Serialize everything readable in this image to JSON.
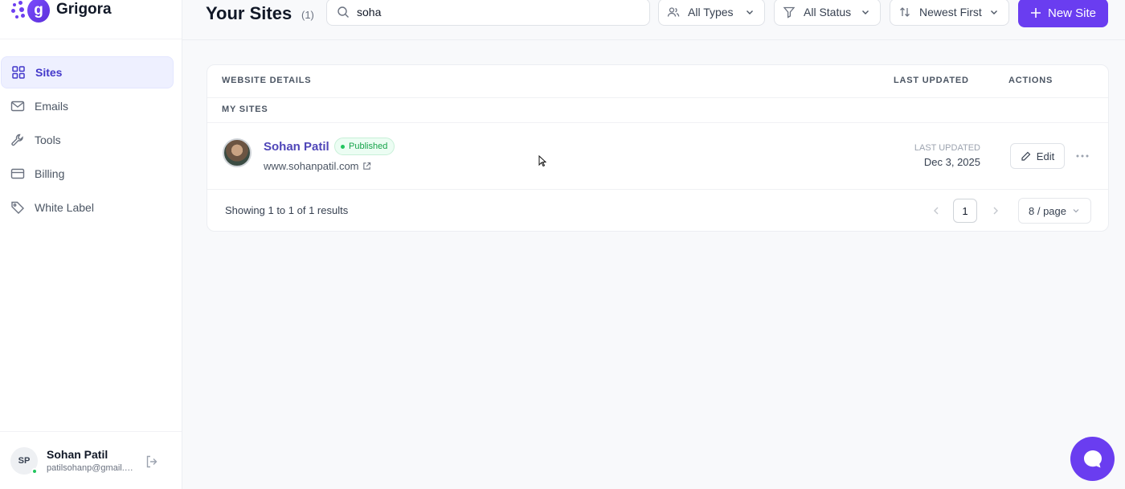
{
  "brand": {
    "name": "Grigora"
  },
  "sidebar": {
    "items": [
      {
        "label": "Sites",
        "icon": "grid-icon",
        "active": true
      },
      {
        "label": "Emails",
        "icon": "mail-icon"
      },
      {
        "label": "Tools",
        "icon": "wrench-icon"
      },
      {
        "label": "Billing",
        "icon": "credit-card-icon"
      },
      {
        "label": "White Label",
        "icon": "tag-icon"
      }
    ]
  },
  "user": {
    "initials": "SP",
    "name": "Sohan Patil",
    "email": "patilsohanp@gmail.com"
  },
  "header": {
    "title": "Your Sites",
    "count": "(1)",
    "search": {
      "value": "soha"
    },
    "filters": [
      {
        "label": "All Types",
        "icon": "users-icon"
      },
      {
        "label": "All Status",
        "icon": "filter-icon"
      },
      {
        "label": "Newest First",
        "icon": "sort-icon"
      }
    ],
    "new_site_label": "New Site"
  },
  "table": {
    "headers": {
      "details": "WEBSITE DETAILS",
      "updated": "LAST UPDATED",
      "actions": "ACTIONS"
    },
    "group_label": "MY SITES",
    "rows": [
      {
        "name": "Sohan Patil",
        "status": "Published",
        "url": "www.sohanpatil.com",
        "updated_label": "LAST UPDATED",
        "updated_date": "Dec 3, 2025",
        "edit_label": "Edit"
      }
    ]
  },
  "pagination": {
    "summary": "Showing 1 to 1 of 1 results",
    "current_page": "1",
    "per_page": "8 / page"
  },
  "colors": {
    "accent": "#6a3df0",
    "link": "#4f46b8",
    "published": "#16a34a"
  }
}
